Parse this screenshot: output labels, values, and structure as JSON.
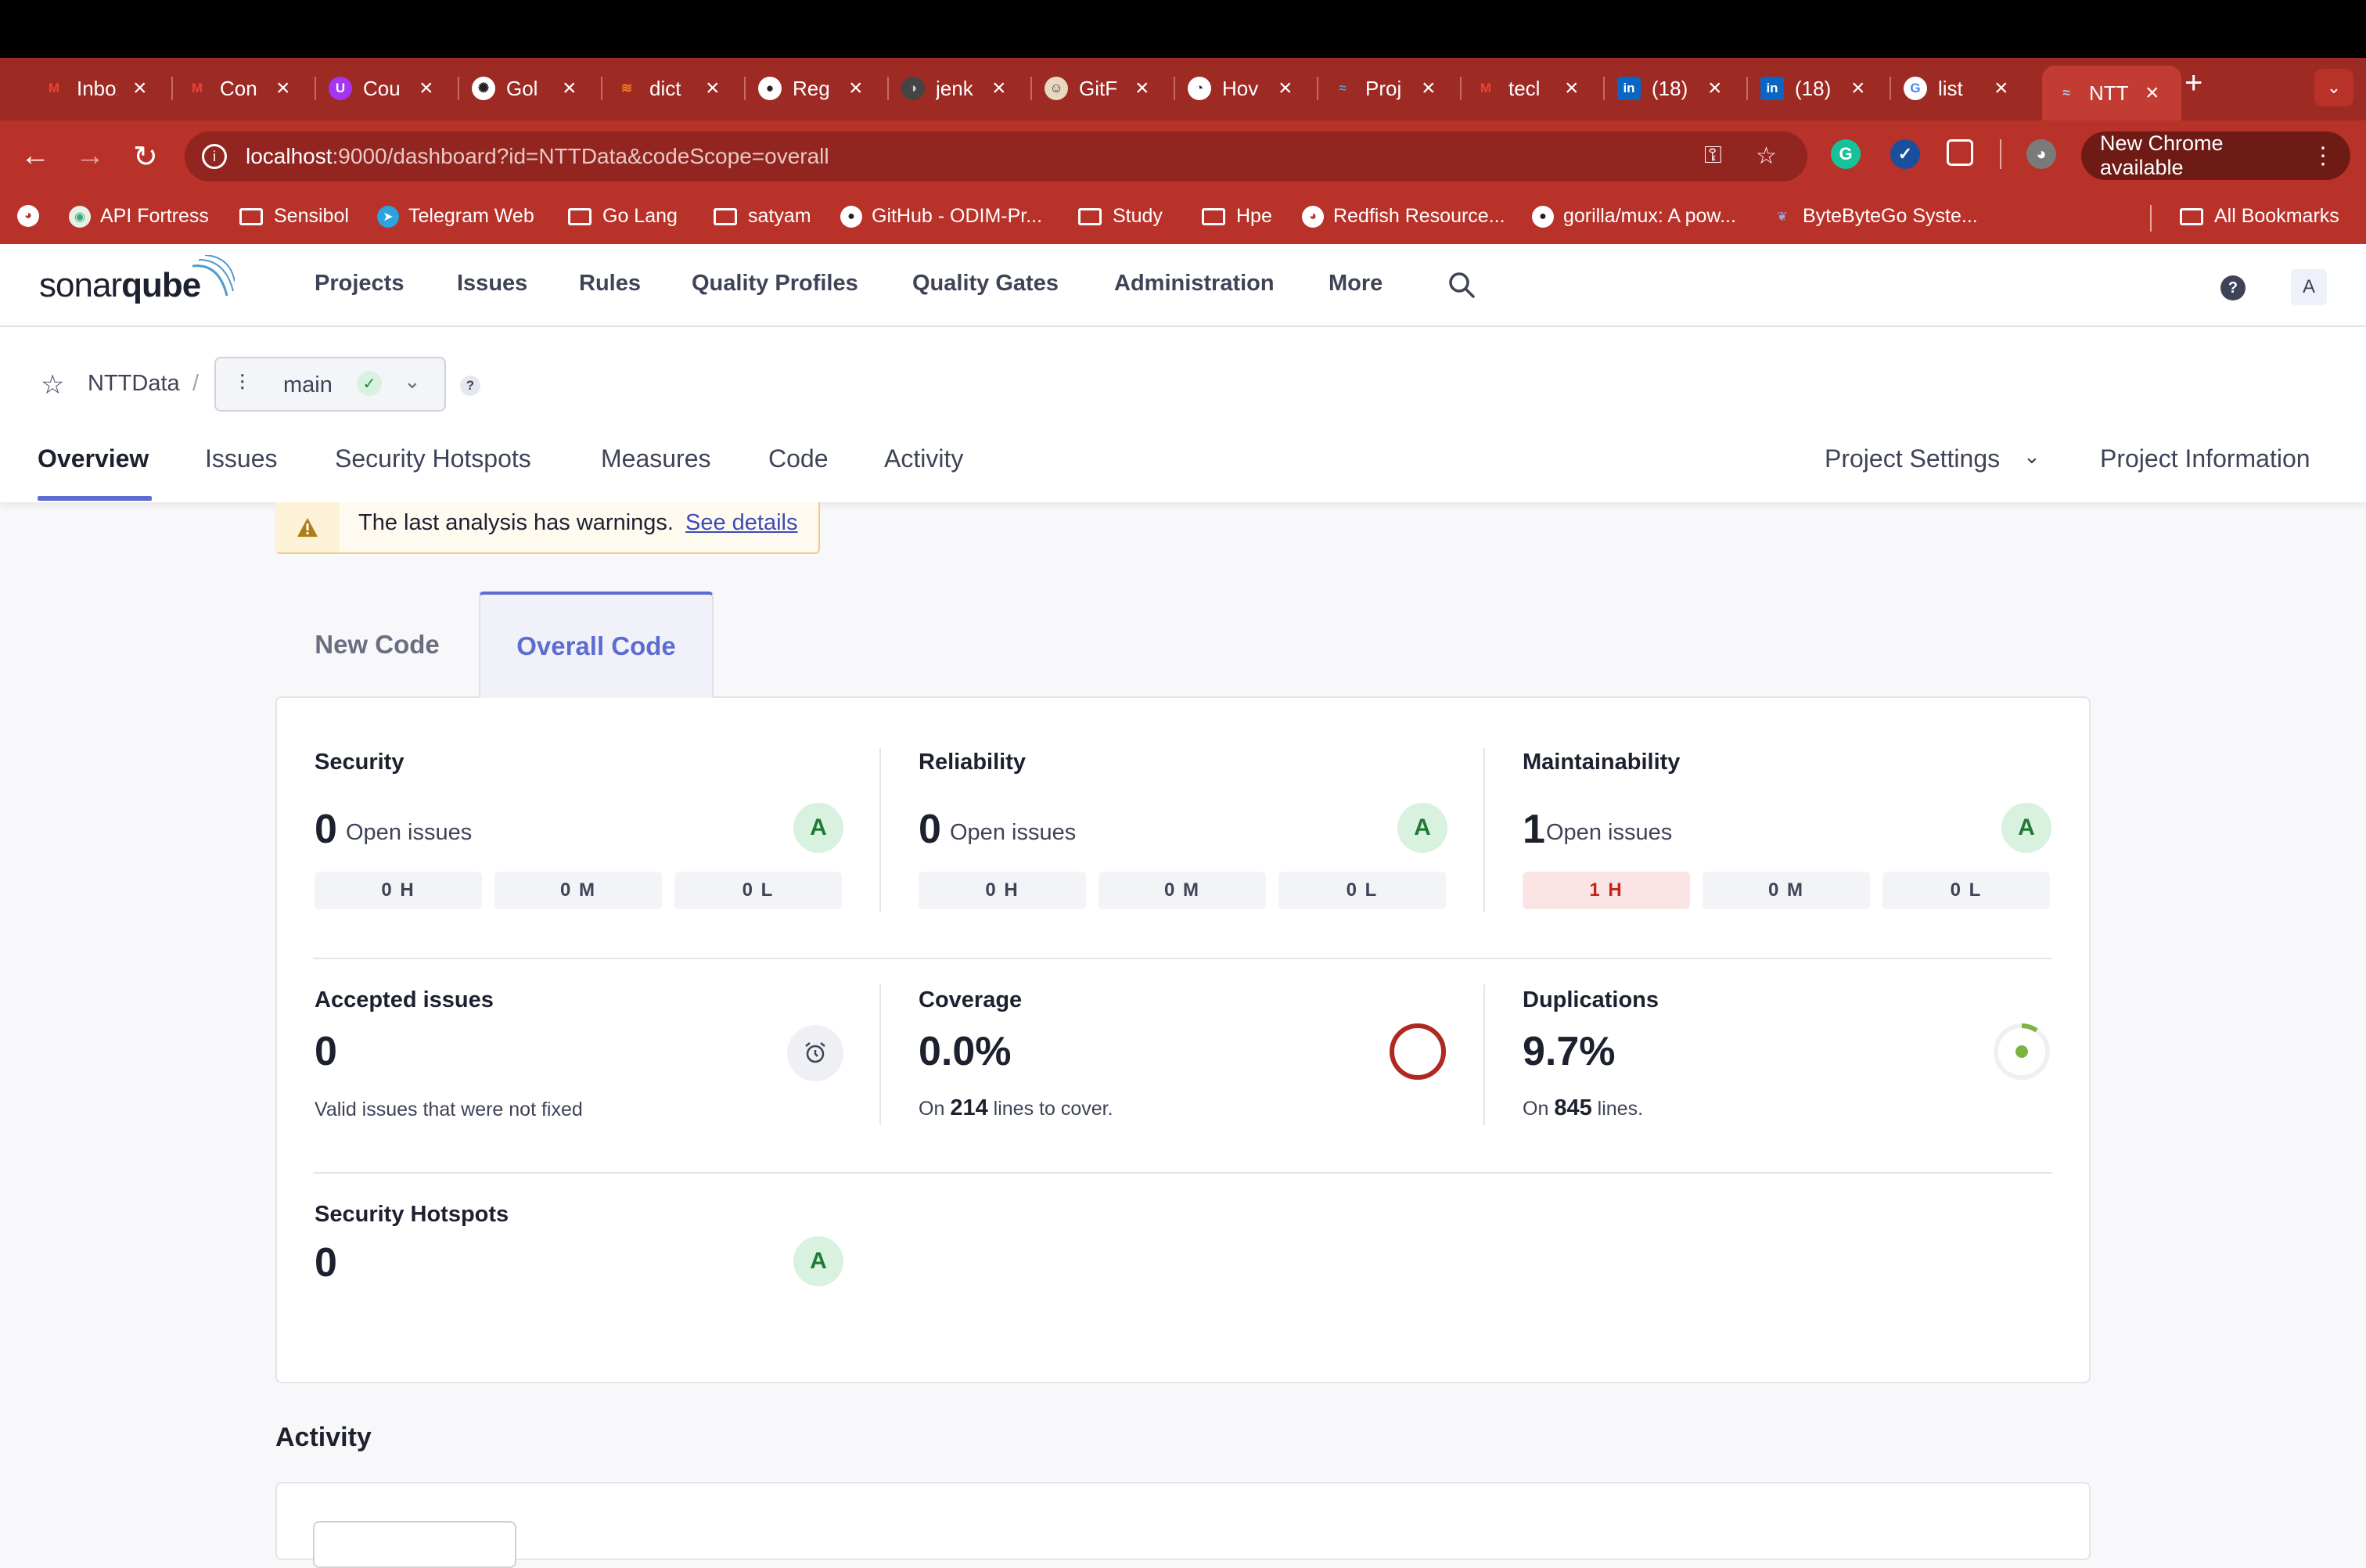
{
  "browser": {
    "tabs": [
      {
        "title": "Inbox",
        "icon": "gmail-icon",
        "color": "#ea4335"
      },
      {
        "title": "Con",
        "icon": "gmail-icon",
        "color": "#ea4335"
      },
      {
        "title": "Cou",
        "icon": "udemy-icon",
        "color": "#a435f0"
      },
      {
        "title": "Gol",
        "icon": "openai-icon",
        "color": "#222222"
      },
      {
        "title": "dict",
        "icon": "stackoverflow-icon",
        "color": "#f48024"
      },
      {
        "title": "Reg",
        "icon": "github-icon",
        "color": "#222222"
      },
      {
        "title": "jenk",
        "icon": "jenkins-icon",
        "color": "#444444"
      },
      {
        "title": "GitF",
        "icon": "gitpod-icon",
        "color": "#888888"
      },
      {
        "title": "Hov",
        "icon": "clock-icon",
        "color": "#222222"
      },
      {
        "title": "Proj",
        "icon": "sonarqube-icon",
        "color": "#4e9bcd"
      },
      {
        "title": "tecl",
        "icon": "gmail-icon",
        "color": "#ea4335"
      },
      {
        "title": "(18)",
        "icon": "linkedin-icon",
        "color": "#0a66c2"
      },
      {
        "title": "(18)",
        "icon": "linkedin-icon",
        "color": "#0a66c2"
      },
      {
        "title": "list",
        "icon": "google-icon",
        "color": "#ffffff"
      },
      {
        "title": "NTT",
        "icon": "sonarqube-icon",
        "color": "#4e9bcd"
      }
    ],
    "url_host": "localhost",
    "url_rest": ":9000/dashboard?id=NTTData&codeScope=overall",
    "new_chrome": "New Chrome available",
    "bookmarks": [
      {
        "label": "API Fortress",
        "kind": "site"
      },
      {
        "label": "Sensibol",
        "kind": "folder"
      },
      {
        "label": "Telegram Web",
        "kind": "site"
      },
      {
        "label": "Go Lang",
        "kind": "folder"
      },
      {
        "label": "satyam",
        "kind": "folder"
      },
      {
        "label": "GitHub - ODIM-Pr...",
        "kind": "site"
      },
      {
        "label": "Study",
        "kind": "folder"
      },
      {
        "label": "Hpe",
        "kind": "folder"
      },
      {
        "label": "Redfish Resource...",
        "kind": "site"
      },
      {
        "label": "gorilla/mux: A pow...",
        "kind": "site"
      },
      {
        "label": "ByteByteGo Syste...",
        "kind": "site"
      }
    ],
    "all_bookmarks": "All Bookmarks"
  },
  "sonar": {
    "logo_a": "sonar",
    "logo_b": "qube",
    "nav": [
      "Projects",
      "Issues",
      "Rules",
      "Quality Profiles",
      "Quality Gates",
      "Administration",
      "More"
    ],
    "avatar": "A",
    "help": "?"
  },
  "project": {
    "name": "NTTData",
    "slash": "/",
    "branch": "main",
    "branch_help": "?",
    "tabs": [
      "Overview",
      "Issues",
      "Security Hotspots",
      "Measures",
      "Code",
      "Activity"
    ],
    "settings": "Project Settings",
    "information": "Project Information"
  },
  "warning": {
    "text": "The last analysis has warnings.",
    "link": "See details"
  },
  "code_tabs": {
    "new": "New Code",
    "overall": "Overall Code"
  },
  "metrics": {
    "open_issues_label": "Open issues",
    "security": {
      "title": "Security",
      "value": "0",
      "grade": "A",
      "high": "0 H",
      "medium": "0 M",
      "low": "0 L"
    },
    "reliability": {
      "title": "Reliability",
      "value": "0",
      "grade": "A",
      "high": "0 H",
      "medium": "0 M",
      "low": "0 L"
    },
    "maintainability": {
      "title": "Maintainability",
      "value": "1",
      "grade": "A",
      "high": "1 H",
      "medium": "0 M",
      "low": "0 L"
    },
    "accepted": {
      "title": "Accepted issues",
      "value": "0",
      "sub": "Valid issues that were not fixed"
    },
    "coverage": {
      "title": "Coverage",
      "value": "0.0%",
      "sub_pre": "On",
      "sub_num": "214",
      "sub_post": "lines to cover.",
      "percent": 0.0
    },
    "duplications": {
      "title": "Duplications",
      "value": "9.7%",
      "sub_pre": "On",
      "sub_num": "845",
      "sub_post": "lines.",
      "percent": 9.7
    },
    "hotspots": {
      "title": "Security Hotspots",
      "value": "0",
      "grade": "A"
    }
  },
  "activity": {
    "title": "Activity"
  },
  "colors": {
    "accent": "#5d6cd0",
    "grade_a_bg": "#d9f2df",
    "high_sev": "#c4241c",
    "chrome_red": "#b8322a"
  }
}
